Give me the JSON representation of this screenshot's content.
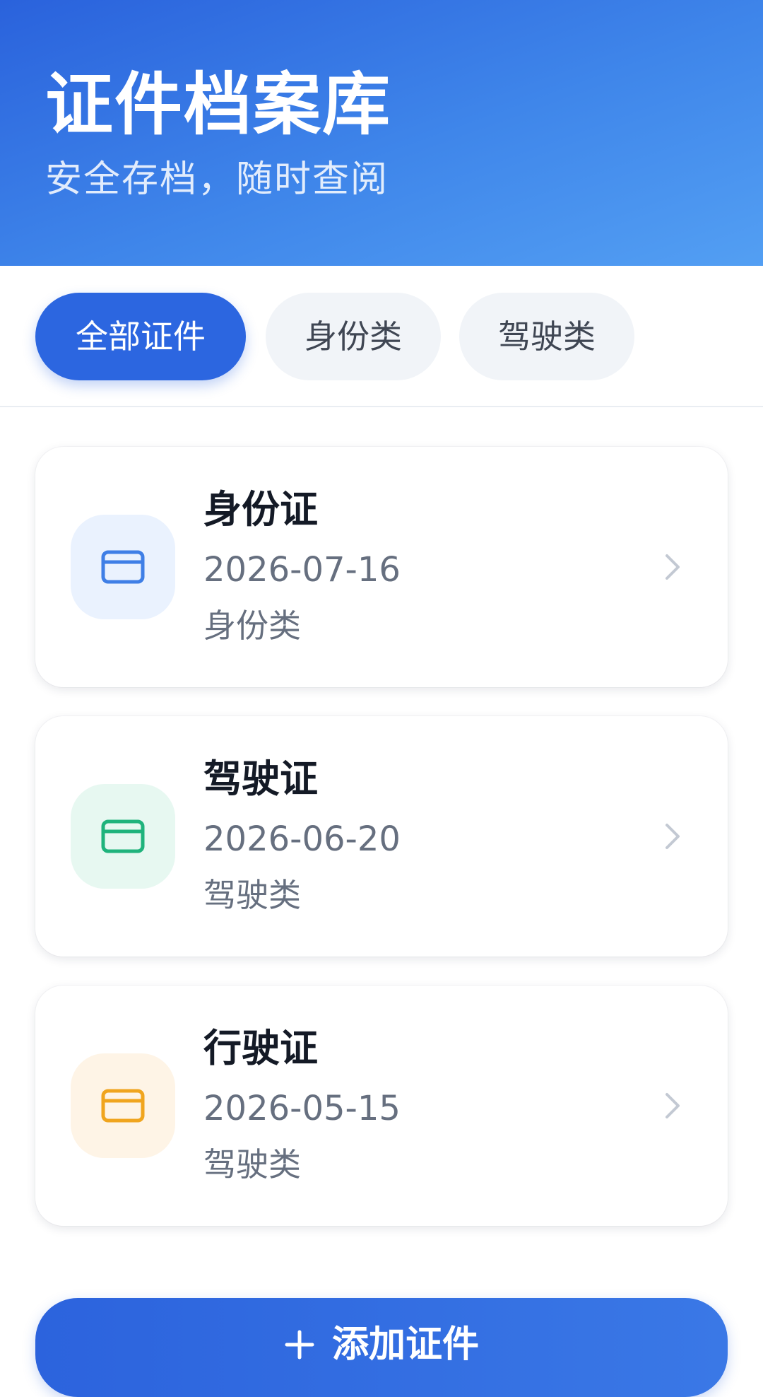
{
  "header": {
    "title": "证件档案库",
    "subtitle": "安全存档，随时查阅"
  },
  "tabs": [
    {
      "label": "全部证件",
      "active": true
    },
    {
      "label": "身份类",
      "active": false
    },
    {
      "label": "驾驶类",
      "active": false
    }
  ],
  "documents": [
    {
      "name": "身份证",
      "date": "2026-07-16",
      "category": "身份类",
      "icon": "id-card-icon",
      "icon_color": "#3f7fe6",
      "icon_bg": "#eaf2fe"
    },
    {
      "name": "驾驶证",
      "date": "2026-06-20",
      "category": "驾驶类",
      "icon": "id-card-icon",
      "icon_color": "#1fb37c",
      "icon_bg": "#e7f8f1"
    },
    {
      "name": "行驶证",
      "date": "2026-05-15",
      "category": "驾驶类",
      "icon": "id-card-icon",
      "icon_color": "#f0a51e",
      "icon_bg": "#fef4e6"
    }
  ],
  "add_button": {
    "label": "添加证件",
    "icon": "plus-icon"
  },
  "colors": {
    "primary": "#2c66e0",
    "header_gradient_start": "#2a62dc",
    "header_gradient_end": "#539ff3"
  }
}
